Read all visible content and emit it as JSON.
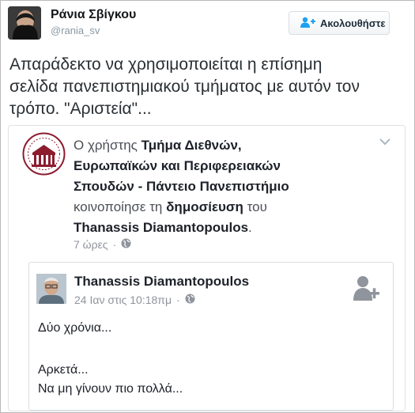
{
  "tweet": {
    "display_name": "Ράνια Σβίγκου",
    "handle": "@rania_sv",
    "follow_label": "Ακολουθήστε",
    "text_lines": [
      "Απαράδεκτο να χρησιμοποιείται η επίσημη",
      "σελίδα πανεπιστημιακού τμήματος με αυτόν τον",
      "τρόπο. \"Αριστεία\"..."
    ]
  },
  "shared_post": {
    "prefix": "Ο χρήστης",
    "page_name_lines": [
      "Τμήμα Διεθνών,",
      "Ευρωπαϊκών και Περιφερειακών",
      "Σπουδών - Πάντειο Πανεπιστήμιο"
    ],
    "shared_word": "κοινοποίησε τη",
    "post_word": "δημοσίευση",
    "of_word": "του",
    "author": "Thanassis Diamantopoulos",
    "author_suffix": ".",
    "time": "7 ώρες",
    "separator": "·"
  },
  "inner_post": {
    "author": "Thanassis Diamantopoulos",
    "timestamp": "24 Ιαν στις 10:18πμ",
    "separator": "·",
    "lines": [
      "Δύο χρόνια...",
      "Αρκετά...",
      "Να μη γίνουν πιο πολλά..."
    ]
  },
  "icons": {
    "follow": "add-user-icon",
    "card_menu": "chevron-down-icon",
    "audience": "globe-icon",
    "add_friend": "add-friend-icon"
  },
  "colors": {
    "link_blue": "#365899",
    "meta_gray": "#90949c",
    "text_dark": "#1d2129"
  }
}
